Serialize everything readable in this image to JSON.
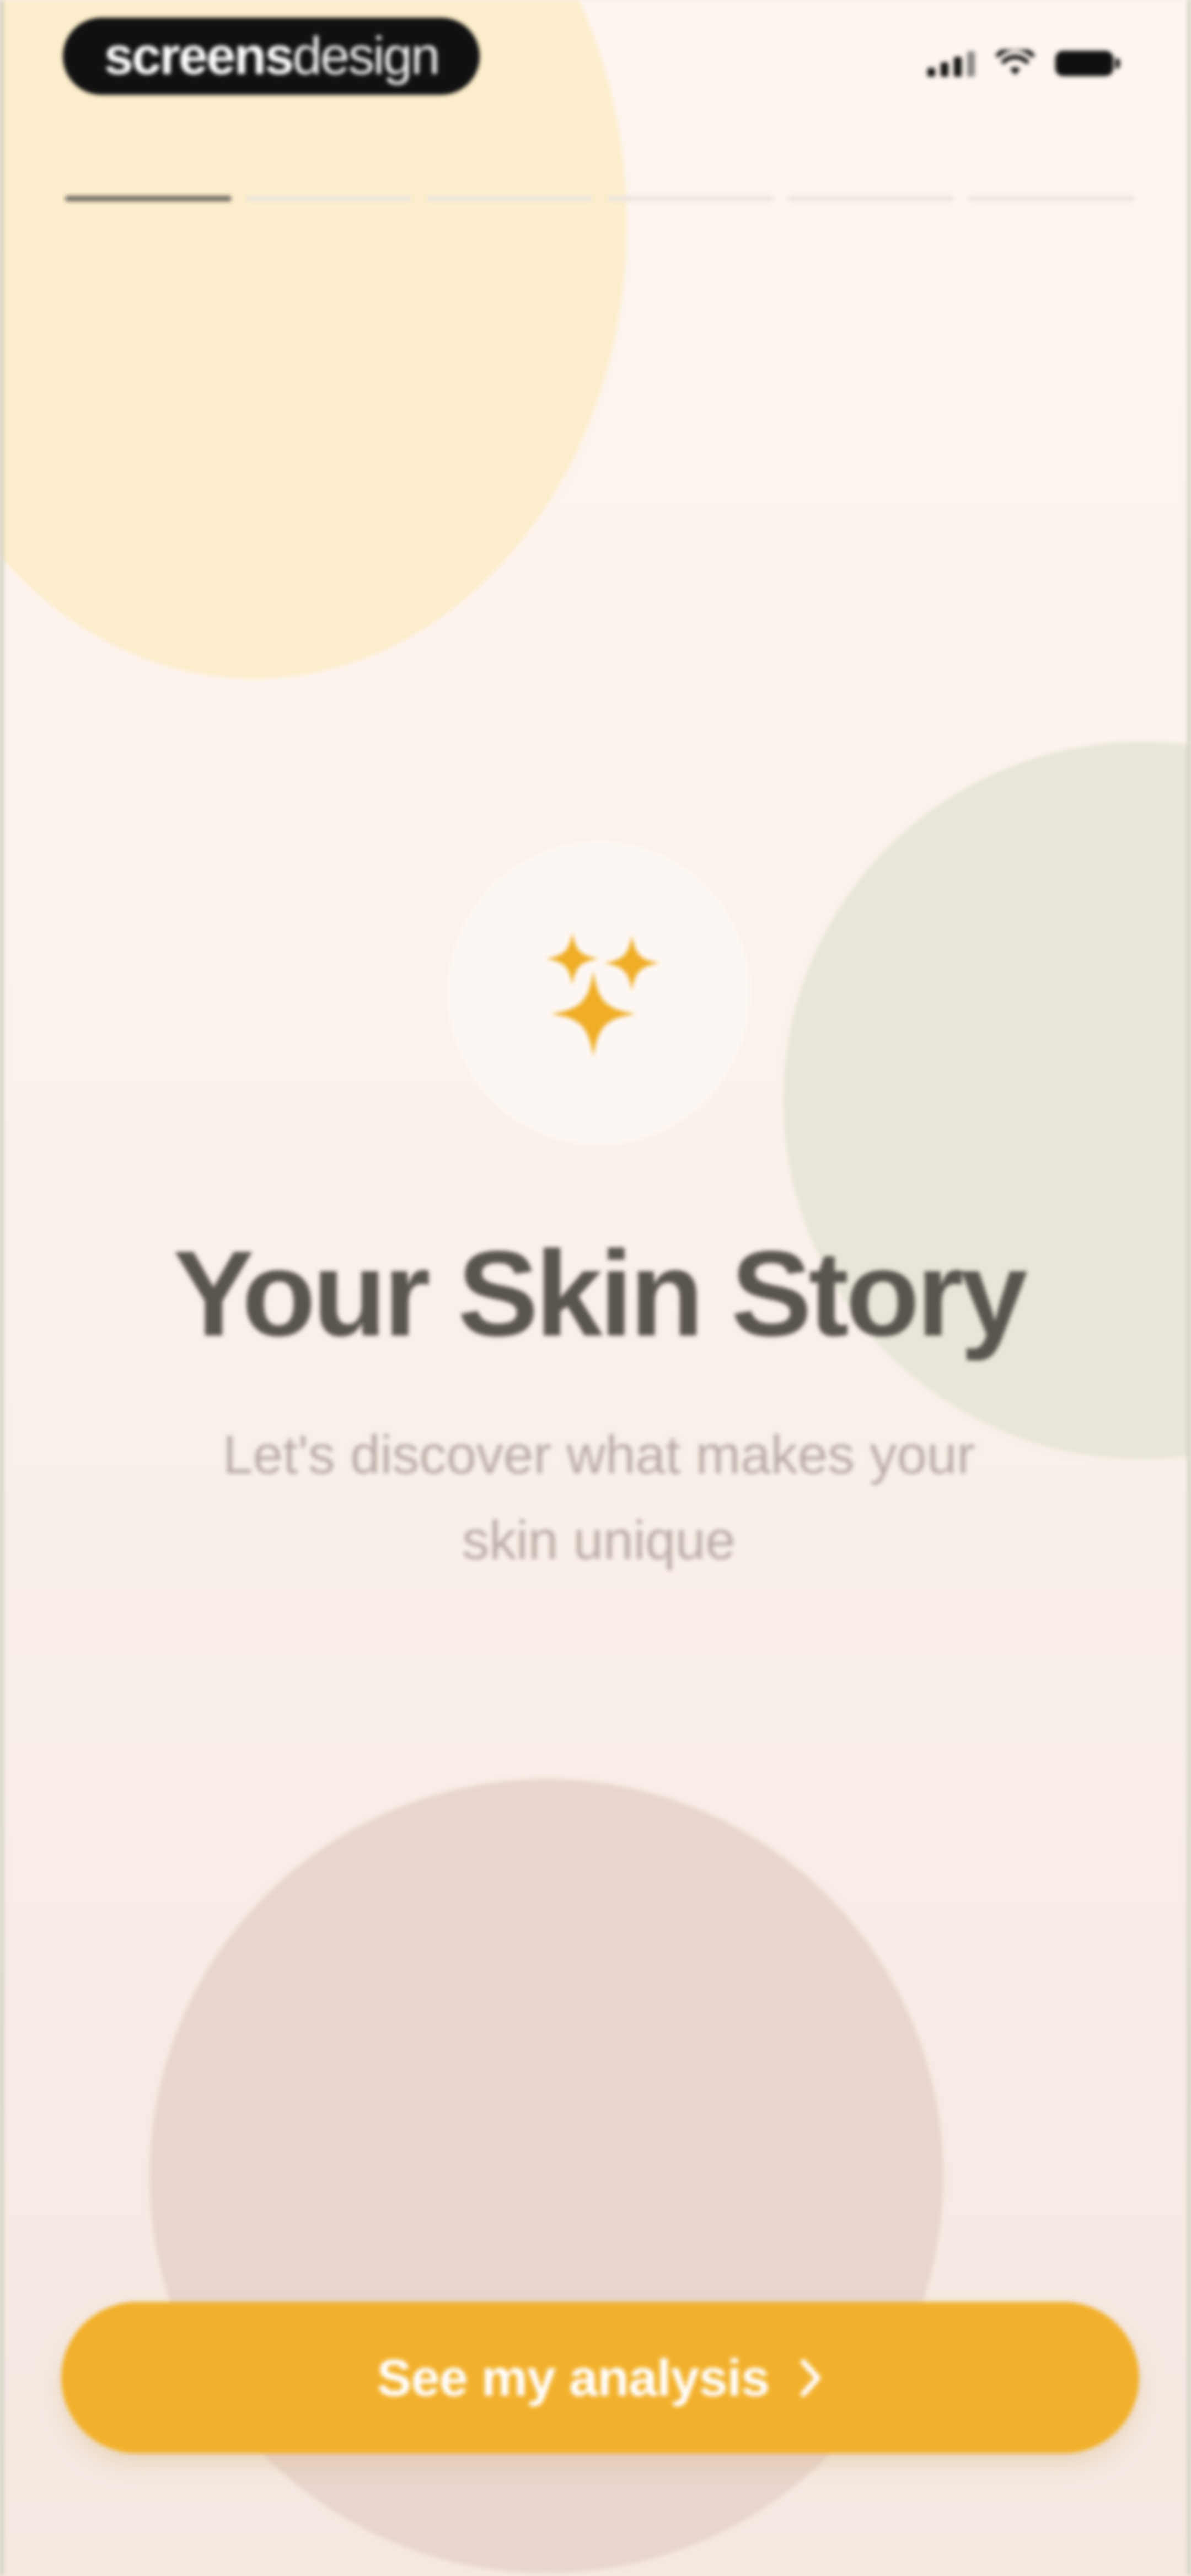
{
  "status_bar": {
    "brand_prefix": "screens",
    "brand_suffix": "design",
    "icons": [
      "cellular-signal-icon",
      "wifi-icon",
      "battery-icon"
    ]
  },
  "progress": {
    "total_steps": 6,
    "current_step": 1
  },
  "hero": {
    "icon": "sparkles-icon",
    "icon_color": "#f0ae27",
    "title": "Your Skin Story",
    "subtitle": "Let's discover what makes your skin unique"
  },
  "cta": {
    "label": "See my analysis",
    "icon": "chevron-right-icon",
    "color": "#f3b22e"
  },
  "colors": {
    "background": "#f9f0ea",
    "blob_yellow": "#fbecca",
    "blob_sage": "#e7e6d8",
    "blob_rose": "#e9d7cf",
    "title": "#5a554f",
    "subtitle": "#b8aea7"
  }
}
